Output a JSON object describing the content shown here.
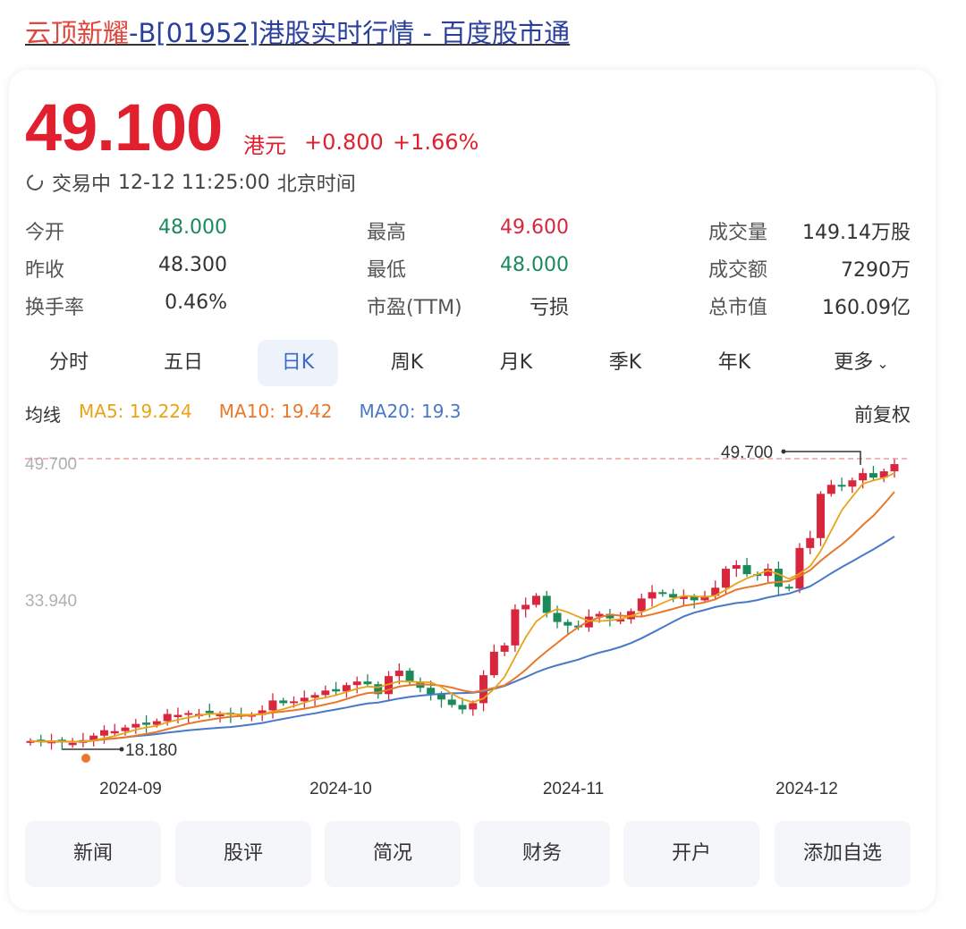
{
  "header": {
    "title_highlight": "云顶新耀",
    "title_rest": "-B[01952]港股实时行情 - 百度股市通"
  },
  "quote": {
    "price": "49.100",
    "unit": "港元",
    "change": "+0.800",
    "change_pct": "+1.66%",
    "status": "交易中",
    "time": "12-12 11:25:00",
    "timezone": "北京时间"
  },
  "metrics": [
    {
      "label": "今开",
      "value": "48.000"
    },
    {
      "label": "最高",
      "value": "49.600"
    },
    {
      "label": "成交量",
      "value": "149.14万股"
    },
    {
      "label": "昨收",
      "value": "48.300"
    },
    {
      "label": "最低",
      "value": "48.000"
    },
    {
      "label": "成交额",
      "value": "7290万"
    },
    {
      "label": "换手率",
      "value": "0.46%"
    },
    {
      "label": "市盈(TTM)",
      "value": "亏损"
    },
    {
      "label": "总市值",
      "value": "160.09亿"
    }
  ],
  "tabs": [
    "分时",
    "五日",
    "日K",
    "周K",
    "月K",
    "季K",
    "年K",
    "更多"
  ],
  "ma": {
    "label": "均线",
    "ma5": "MA5: 19.224",
    "ma10": "MA10: 19.42",
    "ma20": "MA20: 19.3",
    "adjust": "前复权"
  },
  "colors": {
    "up": "#d7263d",
    "down": "#1b8a5a",
    "ma5": "#e8a317",
    "ma10": "#e8782b",
    "ma20": "#4a78c8",
    "accent": "#3b68c9"
  },
  "chart_data": {
    "type": "candlestick",
    "y_ticks": [
      "49.700",
      "33.940"
    ],
    "x_ticks": [
      "2024-09",
      "2024-10",
      "2024-11",
      "2024-12"
    ],
    "high_marker": "49.700",
    "low_marker": "18.180",
    "ylim": [
      18.18,
      49.7
    ],
    "series_close": [
      18.4,
      18.3,
      18.4,
      18.3,
      18.2,
      18.5,
      19.0,
      19.6,
      19.5,
      19.9,
      20.3,
      20.2,
      20.6,
      21.4,
      21.3,
      21.5,
      21.4,
      21.5,
      21.4,
      21.3,
      21.1,
      21.3,
      21.8,
      22.9,
      22.6,
      22.8,
      23.2,
      23.5,
      24.0,
      23.9,
      24.6,
      25.0,
      24.7,
      23.6,
      25.6,
      26.2,
      24.9,
      24.3,
      23.6,
      23.0,
      22.4,
      21.9,
      22.6,
      25.7,
      28.3,
      29.0,
      33.0,
      33.5,
      34.5,
      32.6,
      31.6,
      31.2,
      31.0,
      32.2,
      32.5,
      32.0,
      31.9,
      32.8,
      34.2,
      34.9,
      34.7,
      34.3,
      34.4,
      34.0,
      34.5,
      35.4,
      37.5,
      37.9,
      36.9,
      36.7,
      37.5,
      35.5,
      35.3,
      39.8,
      40.9,
      45.8,
      46.8,
      46.6,
      47.3,
      48.1,
      47.6,
      48.3,
      49.1
    ]
  }
}
